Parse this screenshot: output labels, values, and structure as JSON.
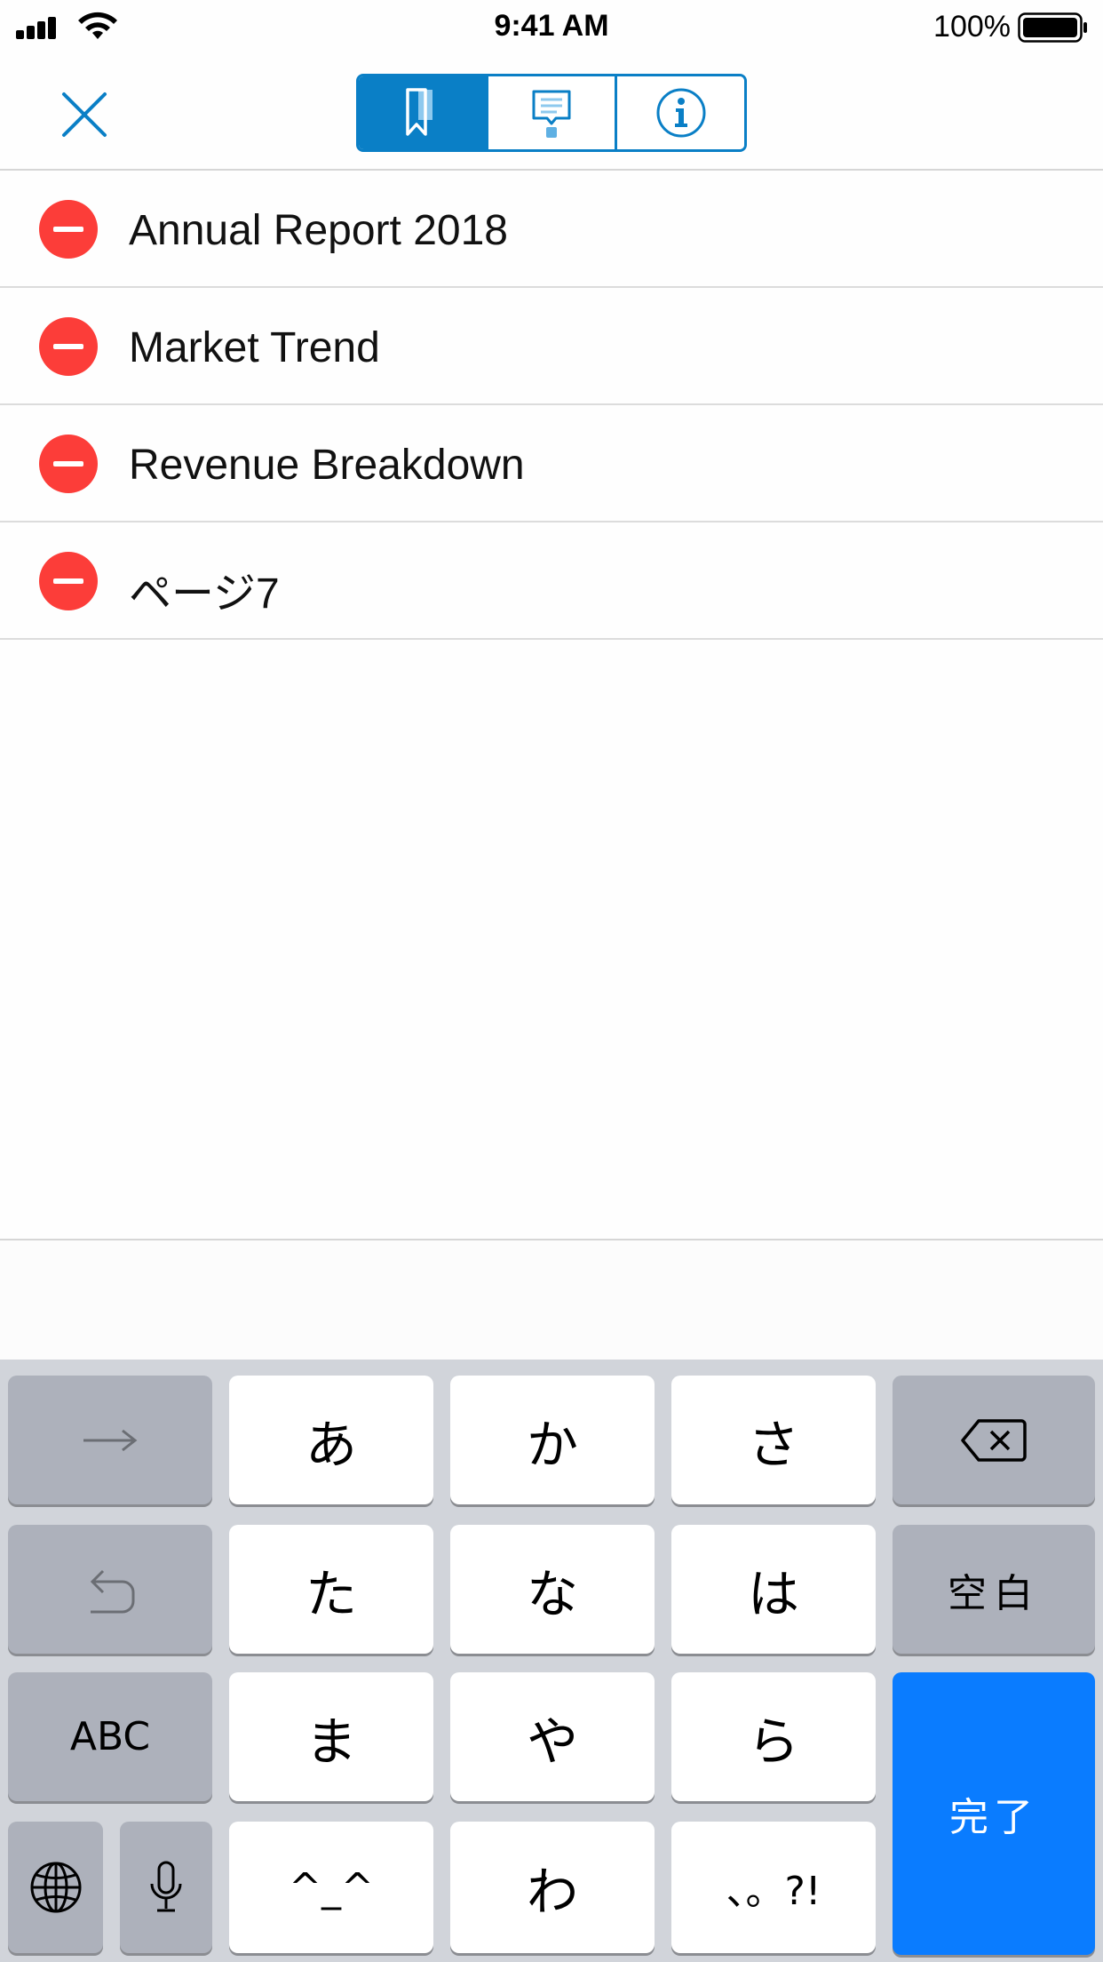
{
  "status_bar": {
    "time": "9:41 AM",
    "battery_percent": "100%"
  },
  "nav": {
    "close_icon": "close-x-icon",
    "segments": [
      {
        "icon": "bookmark-icon",
        "active": true
      },
      {
        "icon": "comment-icon",
        "active": false
      },
      {
        "icon": "info-icon",
        "active": false
      }
    ],
    "accent_color": "#0a7fc6"
  },
  "bookmarks": [
    {
      "label": "Annual Report 2018"
    },
    {
      "label": "Market Trend"
    },
    {
      "label": "Revenue Breakdown"
    },
    {
      "label": "ページ7"
    }
  ],
  "keyboard": {
    "next_key": "→",
    "undo_key": "undo-arrow-icon",
    "abc": "ABC",
    "globe": "globe-icon",
    "mic": "microphone-icon",
    "backspace": "delete-backward-icon",
    "space": "空白",
    "done": "完了",
    "kana": {
      "a": "あ",
      "ka": "か",
      "sa": "さ",
      "ta": "た",
      "na": "な",
      "ha": "は",
      "ma": "ま",
      "ya": "や",
      "ra": "ら",
      "kaomoji": "^_^",
      "wa": "わ",
      "punct": "、。?!"
    },
    "done_color": "#0a7cff",
    "delete_color": "#fc3d39"
  }
}
